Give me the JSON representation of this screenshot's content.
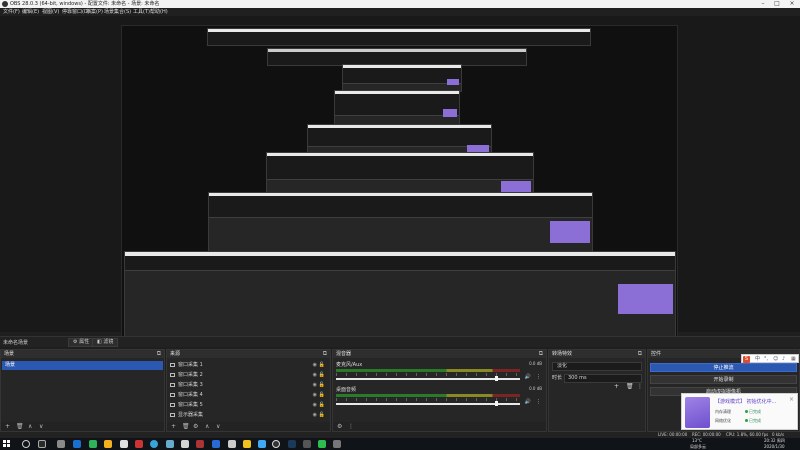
{
  "window": {
    "title": "OBS 28.0.3 (64-bit, windows) - 配置文件: 未命名 - 场景: 未命名"
  },
  "menu": [
    "文件(F)",
    "编辑(E)",
    "视图(V)",
    "停靠窗口(D)",
    "档案(P)",
    "场景集合(S)",
    "工具(T)",
    "帮助(H)"
  ],
  "header_row": {
    "scene_label": "未命名场景",
    "properties_label": "属性",
    "filters_label": "滤镜"
  },
  "scenes": {
    "title": "场景",
    "items": [
      {
        "label": "场景"
      }
    ]
  },
  "sources": {
    "title": "来源",
    "items": [
      {
        "label": "窗口采集 1"
      },
      {
        "label": "窗口采集 2"
      },
      {
        "label": "窗口采集 3"
      },
      {
        "label": "窗口采集 4"
      },
      {
        "label": "窗口采集 5"
      },
      {
        "label": "显示器采集"
      }
    ]
  },
  "mixer": {
    "title": "混音器",
    "channels": [
      {
        "name": "麦克风/Aux",
        "db": "0.0 dB"
      },
      {
        "name": "桌面音频",
        "db": "0.0 dB"
      }
    ]
  },
  "transitions": {
    "title": "转场特效",
    "selected": "淡化",
    "duration_label": "时长",
    "duration_value": "300 ms"
  },
  "controls": {
    "title": "控件",
    "buttons": [
      {
        "label": "停止推流",
        "active": true
      },
      {
        "label": "开始录制",
        "active": false
      },
      {
        "label": "启动虚拟摄像机",
        "active": false
      }
    ]
  },
  "popup": {
    "title": "【游戏模式】 初始优化中...",
    "line1_label": "内存清理",
    "line1_status": "已完成",
    "line2_label": "网络优化",
    "line2_status": "已完成"
  },
  "status": {
    "live": "LIVE: 00:00:00",
    "rec": "REC: 00:00:00",
    "cpu": "CPU: 1.8%, 60.00 fps",
    "kbps": "0 kb/s"
  },
  "taskbar": {
    "weather": "13°C",
    "weather_desc": "局部多云",
    "time": "20:32 周四",
    "date": "2020/1/30"
  },
  "colors": {
    "accent": "#2b58b0",
    "background": "#1f1f1f",
    "popup_accent": "#8b6fd6"
  }
}
